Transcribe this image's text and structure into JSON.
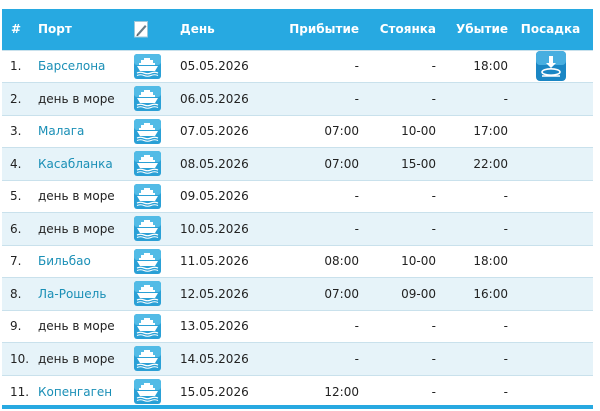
{
  "colors": {
    "header_bg": "#27a9e1",
    "header_text": "#ffffff",
    "row_alt": "#e6f3f9",
    "link": "#1a8fb6",
    "ship_icon": "#2aa0d6"
  },
  "table": {
    "headers": {
      "num": "#",
      "port": "Порт",
      "edit_icon": "edit-icon",
      "day": "День",
      "arrival": "Прибытие",
      "stay": "Стоянка",
      "departure": "Убытие",
      "boarding": "Посадка"
    },
    "rows": [
      {
        "num": "1.",
        "port": "Барселона",
        "link": true,
        "day": "05.05.2026",
        "arrival": "-",
        "stay": "-",
        "departure": "18:00",
        "boarding": true
      },
      {
        "num": "2.",
        "port": "день в море",
        "link": false,
        "day": "06.05.2026",
        "arrival": "-",
        "stay": "-",
        "departure": "-",
        "boarding": false
      },
      {
        "num": "3.",
        "port": "Малага",
        "link": true,
        "day": "07.05.2026",
        "arrival": "07:00",
        "stay": "10-00",
        "departure": "17:00",
        "boarding": false
      },
      {
        "num": "4.",
        "port": "Касабланка",
        "link": true,
        "day": "08.05.2026",
        "arrival": "07:00",
        "stay": "15-00",
        "departure": "22:00",
        "boarding": false
      },
      {
        "num": "5.",
        "port": "день в море",
        "link": false,
        "day": "09.05.2026",
        "arrival": "-",
        "stay": "-",
        "departure": "-",
        "boarding": false
      },
      {
        "num": "6.",
        "port": "день в море",
        "link": false,
        "day": "10.05.2026",
        "arrival": "-",
        "stay": "-",
        "departure": "-",
        "boarding": false
      },
      {
        "num": "7.",
        "port": "Бильбао",
        "link": true,
        "day": "11.05.2026",
        "arrival": "08:00",
        "stay": "10-00",
        "departure": "18:00",
        "boarding": false
      },
      {
        "num": "8.",
        "port": "Ла-Рошель",
        "link": true,
        "day": "12.05.2026",
        "arrival": "07:00",
        "stay": "09-00",
        "departure": "16:00",
        "boarding": false
      },
      {
        "num": "9.",
        "port": "день в море",
        "link": false,
        "day": "13.05.2026",
        "arrival": "-",
        "stay": "-",
        "departure": "-",
        "boarding": false
      },
      {
        "num": "10.",
        "port": "день в море",
        "link": false,
        "day": "14.05.2026",
        "arrival": "-",
        "stay": "-",
        "departure": "-",
        "boarding": false
      },
      {
        "num": "11.",
        "port": "Копенгаген",
        "link": true,
        "day": "15.05.2026",
        "arrival": "12:00",
        "stay": "-",
        "departure": "-",
        "boarding": false
      }
    ],
    "row_icon": "ship-icon",
    "boarding_icon": "boarding-download-icon"
  }
}
